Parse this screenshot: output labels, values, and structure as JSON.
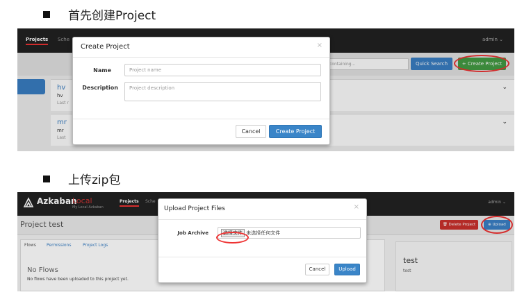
{
  "sections": {
    "create_heading": "首先创建Project",
    "upload_heading": "上传zip包"
  },
  "shot1": {
    "nav": {
      "projects": "Projects",
      "schedule": "Sche",
      "admin": "admin ⌄"
    },
    "search_placeholder": "containing...",
    "quick_search": "Quick Search",
    "create_project": "+ Create Project",
    "projects": [
      {
        "name": "hv",
        "description": "hv",
        "last": "Last r"
      },
      {
        "name": "mr",
        "description": "mr",
        "last": "Last"
      }
    ],
    "modal": {
      "title": "Create Project",
      "close": "×",
      "name_label": "Name",
      "name_placeholder": "Project name",
      "description_label": "Description",
      "description_placeholder": "Project description",
      "cancel": "Cancel",
      "create": "Create Project"
    }
  },
  "shot2": {
    "brand": "Azkaban",
    "local": "Local",
    "subtitle": "My Local Azkaban",
    "nav": {
      "projects": "Projects",
      "schedule": "Sche",
      "admin": "admin ⌄"
    },
    "project_title": "Project test",
    "delete_project": "🗑 Delete Project",
    "upload": "⊕ Upload",
    "tabs": [
      "Flows",
      "Permissions",
      "Project Logs"
    ],
    "no_flows": "No Flows",
    "no_flows_sub": "No flows have been uploaded to this project yet.",
    "side_title": "test",
    "side_desc": "test",
    "modal": {
      "title": "Upload Project Files",
      "close": "×",
      "job_archive_label": "Job Archive",
      "choose_file": "选择文件",
      "no_file": "未选择任何文件",
      "cancel": "Cancel",
      "upload": "Upload"
    }
  }
}
